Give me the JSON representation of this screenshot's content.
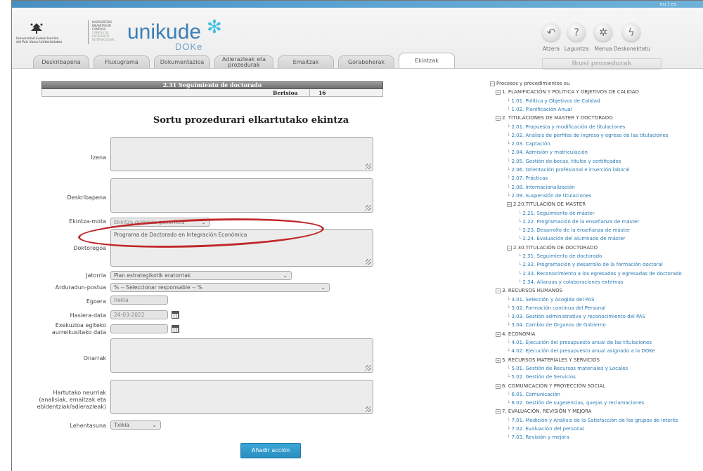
{
  "header": {
    "lang": "eu | es",
    "ehu_line1": "Universidad   Euskal Herriko",
    "ehu_line2": "del País Vasco   Unibertsitatea",
    "campus_lines": [
      "NAZIOARTEKO",
      "BIKAINTASUN",
      "CAMPUSA",
      "CAMPUS DE",
      "EXCELENCIA",
      "INTERNACIONAL"
    ],
    "brand": "unikude",
    "brand_sub": "DOKe",
    "tools": [
      {
        "label": "Atzera",
        "icon": "back-arrow-icon",
        "glyph": "↶"
      },
      {
        "label": "Laguntza",
        "icon": "help-icon",
        "glyph": "?"
      },
      {
        "label": "Menua",
        "icon": "menu-icon",
        "glyph": "✲"
      },
      {
        "label": "Deskonektatu",
        "icon": "disconnect-icon",
        "glyph": "ϟ"
      }
    ],
    "ikusi": "Ikusi prozedurak"
  },
  "tabs": [
    {
      "label": "Deskribapena"
    },
    {
      "label": "Fluxugrama"
    },
    {
      "label": "Dokumentazioa"
    },
    {
      "label": "Adierazleak eta prozedurak"
    },
    {
      "label": "Emaitzak"
    },
    {
      "label": "Gorabeherak"
    },
    {
      "label": "Ekintzak"
    }
  ],
  "procedure": {
    "title": "2.31 Seguimiento de doctorado",
    "version_label": "Bertsioa",
    "version": "16"
  },
  "form": {
    "title": "Sortu prozedurari elkartutako ekintza",
    "izena_label": "Izena",
    "izena_value": "",
    "deskribapena_label": "Deskribapena",
    "deskribapena_value": "",
    "ekintza_mota_label": "Ekintza-mota",
    "ekintza_mota_value": "Ekintza orokorra generikoa",
    "doktoregoa_label": "Doktoregoa",
    "doktoregoa_value": "Programa de Doctorado en Integración Económica",
    "jatorria_label": "Jatorria",
    "jatorria_value": "Plan estrategikotik eratorriak",
    "arduradun_label": "Arduradun-postua",
    "arduradun_value": "% -- Seleccionar responsable -- %",
    "egoera_label": "Egoera",
    "egoera_value": "Irekia",
    "hasiera_label": "Hasiera-data",
    "hasiera_value": "24-03-2022",
    "exekuzioa_label_1": "Exekuzioa egiteko",
    "exekuzioa_label_2": "aurreikusitako data",
    "exekuzioa_value": "",
    "onarrak_label": "Onarrak",
    "hartutako_label_1": "Hartutako neurriak",
    "hartutako_label_2": "(analisiak, emaitzak eta",
    "hartutako_label_3": "ebidentziak/adierazleak)",
    "lehentasuna_label": "Lehentasuna",
    "lehentasuna_value": "Txikia",
    "submit": "Añadir acción"
  },
  "tree": {
    "root": "Procesos y procedimientos eu",
    "items": [
      {
        "text": "1. PLANIFICACIÓN Y POLÍTICA Y OBJETIVOS DE CALIDAD",
        "kind": "sec"
      },
      {
        "text": "1.01. Política y Objetivos de Calidad",
        "kind": "leaf"
      },
      {
        "text": "1.02. Planificación Anual",
        "kind": "leaf"
      },
      {
        "text": "2. TITULACIONES DE MÁSTER Y DOCTORADO",
        "kind": "sec"
      },
      {
        "text": "2.01. Propuesta y modificación de titulaciones",
        "kind": "leaf"
      },
      {
        "text": "2.02. Análisis de perfiles de ingreso y egreso de las titulaciones",
        "kind": "leaf"
      },
      {
        "text": "2.03. Captación",
        "kind": "leaf"
      },
      {
        "text": "2.04. Admisión y matriculación",
        "kind": "leaf"
      },
      {
        "text": "2.05. Gestión de becas, títulos y certificados",
        "kind": "leaf"
      },
      {
        "text": "2.06. Orientación profesional e inserción laboral",
        "kind": "leaf"
      },
      {
        "text": "2.07. Prácticas",
        "kind": "leaf"
      },
      {
        "text": "2.08. Internacionalización",
        "kind": "leaf"
      },
      {
        "text": "2.09. Suspensión de titulaciones",
        "kind": "leaf"
      },
      {
        "text": "2.20.TITULACIÓN DE MÁSTER",
        "kind": "sec"
      },
      {
        "text": "2.21. Seguimiento de máster",
        "kind": "leaf"
      },
      {
        "text": "2.22. Programación de la enseñanza de máster",
        "kind": "leaf"
      },
      {
        "text": "2.23. Desarrollo de la enseñanza de máster",
        "kind": "leaf"
      },
      {
        "text": "2.24. Evaluación del alumnado de máster",
        "kind": "leaf"
      },
      {
        "text": "2.30.TITULACIÓN DE DOCTORADO",
        "kind": "sec"
      },
      {
        "text": "2.31. Seguimiento de doctorado",
        "kind": "leaf"
      },
      {
        "text": "2.32. Programación y desarrollo de la formación doctoral",
        "kind": "leaf"
      },
      {
        "text": "2.33. Reconocimiento a los egresados y egresadas de doctorado",
        "kind": "leaf"
      },
      {
        "text": "2.34. Alianzas y colaboraciones externas",
        "kind": "leaf"
      },
      {
        "text": "3. RECURSOS HUMANOS",
        "kind": "sec"
      },
      {
        "text": "3.01. Selección y Acogida del PAS",
        "kind": "leaf"
      },
      {
        "text": "3.02. Formación continua del Personal",
        "kind": "leaf"
      },
      {
        "text": "3.03. Gestión administrativa y reconocimiento del PAS",
        "kind": "leaf"
      },
      {
        "text": "3.04. Cambio de Órganos de Gobierno",
        "kind": "leaf"
      },
      {
        "text": "4. ECONOMÍA",
        "kind": "sec"
      },
      {
        "text": "4.01. Ejecución del presupuesto anual de las titulaciones",
        "kind": "leaf"
      },
      {
        "text": "4.02. Ejecución del presupuesto anual asignado a la DOKe",
        "kind": "leaf"
      },
      {
        "text": "5. RECURSOS MATERIALES Y SERVICIOS",
        "kind": "sec"
      },
      {
        "text": "5.01. Gestión de Recursos materiales y Locales",
        "kind": "leaf"
      },
      {
        "text": "5.02. Gestión de Servicios",
        "kind": "leaf"
      },
      {
        "text": "6. COMUNICACIÓN Y PROYECCIÓN SOCIAL",
        "kind": "sec"
      },
      {
        "text": "6.01. Comunicación",
        "kind": "leaf"
      },
      {
        "text": "6.02. Gestión de sugerencias, quejas y reclamaciones",
        "kind": "leaf"
      },
      {
        "text": "7. EVALUACIÓN, REVISIÓN Y MEJORA",
        "kind": "sec"
      },
      {
        "text": "7.01. Medición y Análisis de la Satisfacción de los grupos de interés",
        "kind": "leaf"
      },
      {
        "text": "7.02. Evaluación del personal",
        "kind": "leaf"
      },
      {
        "text": "7.03. Revisión y mejora",
        "kind": "leaf"
      }
    ]
  },
  "colors": {
    "accent": "#3b7fb5",
    "link": "#2b7ab3",
    "highlight_oval": "#c0282a",
    "button": "#2a8ec0"
  }
}
